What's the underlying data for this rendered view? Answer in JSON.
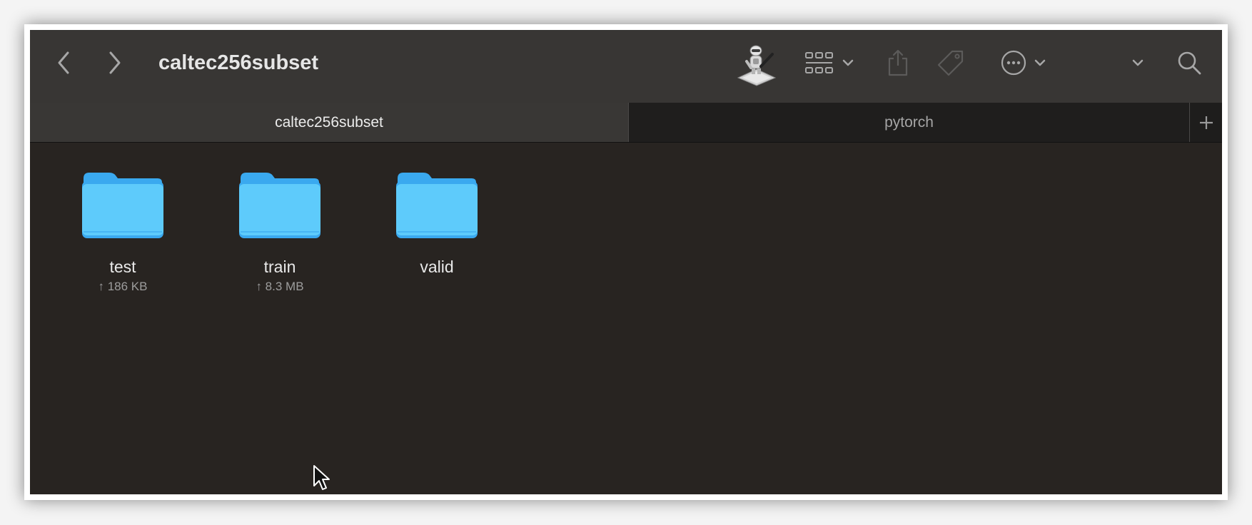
{
  "window": {
    "title": "caltec256subset"
  },
  "toolbar": {
    "back_icon": "chevron-left-icon",
    "forward_icon": "chevron-right-icon",
    "automator_icon": "automator-robot-icon",
    "view_icon": "icon-grid-view-icon",
    "share_icon": "share-icon",
    "tag_icon": "tag-icon",
    "more_icon": "ellipsis-circle-icon",
    "overflow_icon": "chevron-down-icon",
    "search_icon": "search-icon"
  },
  "tabs": [
    {
      "label": "caltec256subset",
      "active": true
    },
    {
      "label": "pytorch",
      "active": false
    }
  ],
  "tab_add_label": "+",
  "files": [
    {
      "name": "test",
      "size": "↑ 186 KB",
      "type": "folder"
    },
    {
      "name": "train",
      "size": "↑ 8.3 MB",
      "type": "folder"
    },
    {
      "name": "valid",
      "size": "",
      "type": "folder"
    }
  ],
  "colors": {
    "folder_blue": "#5ecbfb",
    "folder_tab_blue": "#3aa9ef",
    "background": "#282421",
    "toolbar": "#383634"
  }
}
